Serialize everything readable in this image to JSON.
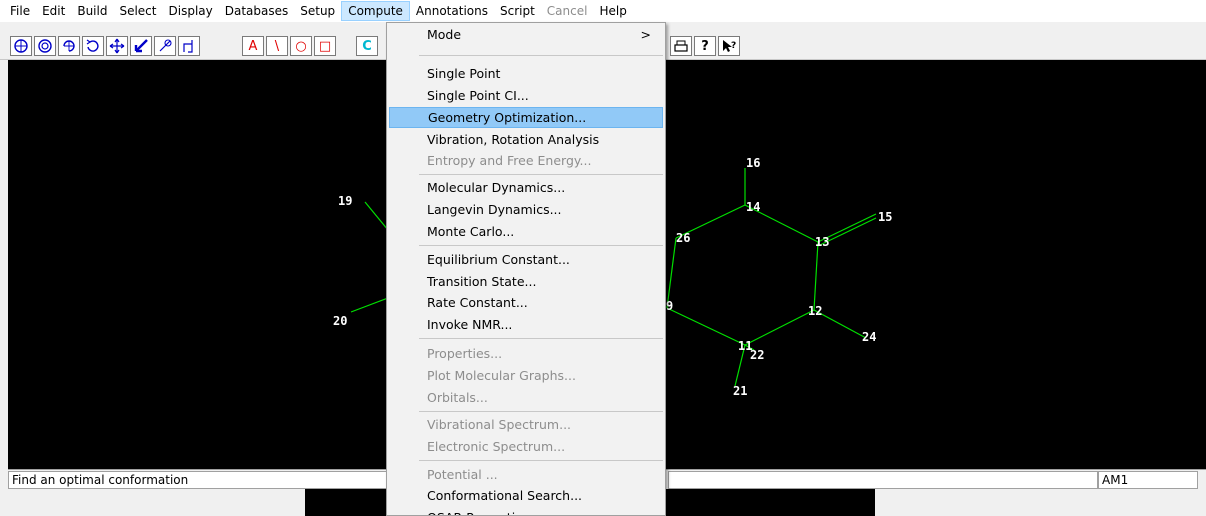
{
  "menubar": {
    "items": [
      {
        "label": "File",
        "state": "normal"
      },
      {
        "label": "Edit",
        "state": "normal"
      },
      {
        "label": "Build",
        "state": "normal"
      },
      {
        "label": "Select",
        "state": "normal"
      },
      {
        "label": "Display",
        "state": "normal"
      },
      {
        "label": "Databases",
        "state": "normal"
      },
      {
        "label": "Setup",
        "state": "normal"
      },
      {
        "label": "Compute",
        "state": "active"
      },
      {
        "label": "Annotations",
        "state": "normal"
      },
      {
        "label": "Script",
        "state": "normal"
      },
      {
        "label": "Cancel",
        "state": "disabled"
      },
      {
        "label": "Help",
        "state": "normal"
      }
    ]
  },
  "toolbar": {
    "left_tools": [
      "draw-ring-tool-icon",
      "select-ring-tool-icon",
      "rotate-out-of-plane-icon",
      "rotate-in-plane-icon",
      "translate-icon",
      "z-translate-icon",
      "zoom-icon",
      "z-clip-icon"
    ],
    "text_tools": [
      {
        "label": "A",
        "color": "#e00000"
      },
      {
        "label": "\\",
        "color": "#e00000"
      },
      {
        "label": "○",
        "color": "#e00000"
      },
      {
        "label": "□",
        "color": "#e00000"
      },
      {
        "label": "C",
        "color": "#00b8d0"
      }
    ],
    "right_tools": [
      "print-icon",
      "help-icon",
      "context-help-icon"
    ]
  },
  "compute_menu": {
    "items": [
      {
        "label": "Mode",
        "disabled": false,
        "submenu": true,
        "arrow": ">"
      },
      {
        "separator": true
      },
      {
        "label": "Single Point",
        "disabled": false
      },
      {
        "label": "Single Point CI...",
        "disabled": false
      },
      {
        "label": "Geometry Optimization...",
        "disabled": false,
        "highlighted": true
      },
      {
        "label": "Vibration, Rotation Analysis",
        "disabled": false
      },
      {
        "label": "Entropy and Free Energy...",
        "disabled": true
      },
      {
        "separator": true
      },
      {
        "label": "Molecular Dynamics...",
        "disabled": false
      },
      {
        "label": "Langevin Dynamics...",
        "disabled": false
      },
      {
        "label": "Monte Carlo...",
        "disabled": false
      },
      {
        "separator": true
      },
      {
        "label": "Equilibrium Constant...",
        "disabled": false
      },
      {
        "label": "Transition State...",
        "disabled": false
      },
      {
        "label": "Rate Constant...",
        "disabled": false
      },
      {
        "label": "Invoke NMR...",
        "disabled": false
      },
      {
        "separator": true
      },
      {
        "label": "Properties...",
        "disabled": true
      },
      {
        "label": "Plot Molecular Graphs...",
        "disabled": true
      },
      {
        "label": "Orbitals...",
        "disabled": true
      },
      {
        "separator": true
      },
      {
        "label": "Vibrational Spectrum...",
        "disabled": true
      },
      {
        "label": "Electronic Spectrum...",
        "disabled": true
      },
      {
        "separator": true
      },
      {
        "label": "Potential ...",
        "disabled": true
      },
      {
        "label": "Conformational Search...",
        "disabled": false
      },
      {
        "label": "QSAR Properties...",
        "disabled": false
      }
    ]
  },
  "molecule": {
    "atom_labels": [
      "19",
      "20",
      "16",
      "14",
      "15",
      "13",
      "26",
      "9",
      "12",
      "24",
      "11",
      "22",
      "21"
    ],
    "bond_color": "#00e000",
    "background": "#000000"
  },
  "statusbar": {
    "message": "Find an optimal conformation",
    "method": "AM1"
  }
}
